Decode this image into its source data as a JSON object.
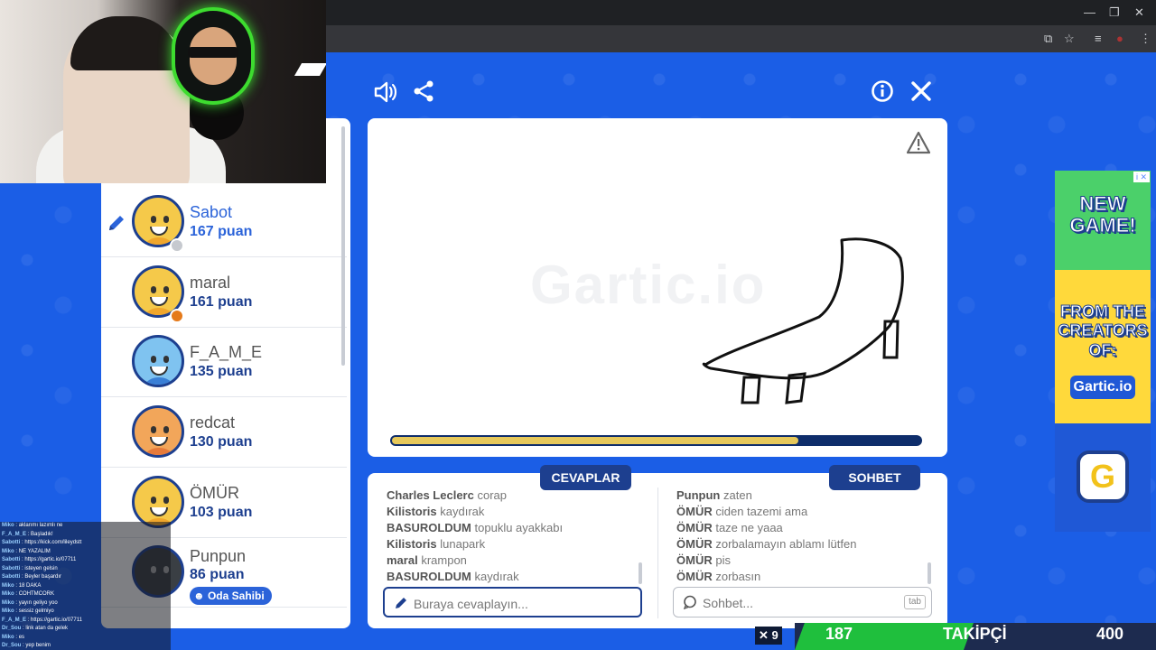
{
  "browser": {
    "win_controls": [
      "—",
      "❐",
      "✕"
    ],
    "addr_icons": [
      "⧉",
      "☆",
      "≡",
      "●",
      "⋮"
    ]
  },
  "toolbar": {
    "sound_icon": "sound-icon",
    "share_icon": "share-icon",
    "info_icon": "info-icon",
    "close_icon": "close-icon"
  },
  "players": [
    {
      "name": "Sabot",
      "score": "167 puan",
      "drawing": true,
      "status": "#c6c9cf",
      "avatar": "#f5c94a"
    },
    {
      "name": "maral",
      "score": "161 puan",
      "status": "#e57a1a",
      "avatar": "#f5c94a"
    },
    {
      "name": "F_A_M_E",
      "score": "135 puan",
      "avatar": "#7fc3f0"
    },
    {
      "name": "redcat",
      "score": "130 puan",
      "avatar": "#f2a65a"
    },
    {
      "name": "ÖMÜR",
      "score": "103 puan",
      "avatar": "#f5c94a"
    },
    {
      "name": "Punpun",
      "score": "86 puan",
      "host_badge": "Oda Sahibi",
      "avatar": "#3a3f44"
    }
  ],
  "canvas": {
    "watermark": "Gartic.io",
    "timer_progress": 0.77
  },
  "tabs": {
    "answers": "CEVAPLAR",
    "chat": "SOHBET"
  },
  "answers": [
    {
      "user": "Charles Leclerc",
      "text": "corap"
    },
    {
      "user": "Kilistoris",
      "text": "kaydırak"
    },
    {
      "user": "BASUROLDUM",
      "text": "topuklu ayakkabı"
    },
    {
      "user": "Kilistoris",
      "text": "lunapark"
    },
    {
      "user": "maral",
      "text": "krampon"
    },
    {
      "user": "BASUROLDUM",
      "text": "kaydırak"
    }
  ],
  "chat": [
    {
      "user": "Punpun",
      "text": "zaten"
    },
    {
      "user": "ÖMÜR",
      "text": "ciden tazemi ama"
    },
    {
      "user": "ÖMÜR",
      "text": "taze ne yaaa"
    },
    {
      "user": "ÖMÜR",
      "text": "zorbalamayın ablamı lütfen"
    },
    {
      "user": "ÖMÜR",
      "text": "pis"
    },
    {
      "user": "ÖMÜR",
      "text": "zorbasın"
    }
  ],
  "answer_input": {
    "placeholder": "Buraya cevaplayın..."
  },
  "chat_input": {
    "placeholder": "Sohbet...",
    "tab_key": "tab"
  },
  "ad": {
    "line1": "NEW",
    "line2": "GAME!",
    "line3": "FROM THE",
    "line4": "CREATORS",
    "line5": "OF:",
    "logo": "Gartic.io",
    "badge_letter": "G",
    "info": "i ✕"
  },
  "follower_goal": {
    "current": "187",
    "label": "TAKİPÇİ",
    "target": "400",
    "progress": 0.4675,
    "x_label": "✕ 9"
  },
  "stream_chat": [
    {
      "user": "Miko",
      "text": "aklarımı lazımlı ne"
    },
    {
      "user": "F_A_M_E",
      "text": "Başladık!"
    },
    {
      "user": "Sabotti",
      "text": "https://kick.com/lileydstt"
    },
    {
      "user": "Miko",
      "text": "NE YAZALIM"
    },
    {
      "user": "Sabotti",
      "text": "https://gartic.io/07711"
    },
    {
      "user": "Sabotti",
      "text": "isteyen gelsin"
    },
    {
      "user": "Sabotti",
      "text": "Beyler başardır"
    },
    {
      "user": "Miko",
      "text": "18 DAKA"
    },
    {
      "user": "Miko",
      "text": "COHTMCORK"
    },
    {
      "user": "Miko",
      "text": "yayın geliyo yoo"
    },
    {
      "user": "Miko",
      "text": "sessiz gelmiyo"
    },
    {
      "user": "F_A_M_E",
      "text": "https://gartic.io/07711"
    },
    {
      "user": "Dr_Sou",
      "text": "link atan da gelek"
    },
    {
      "user": "Miko",
      "text": "es"
    },
    {
      "user": "Dr_Sou",
      "text": "yep benim"
    }
  ]
}
